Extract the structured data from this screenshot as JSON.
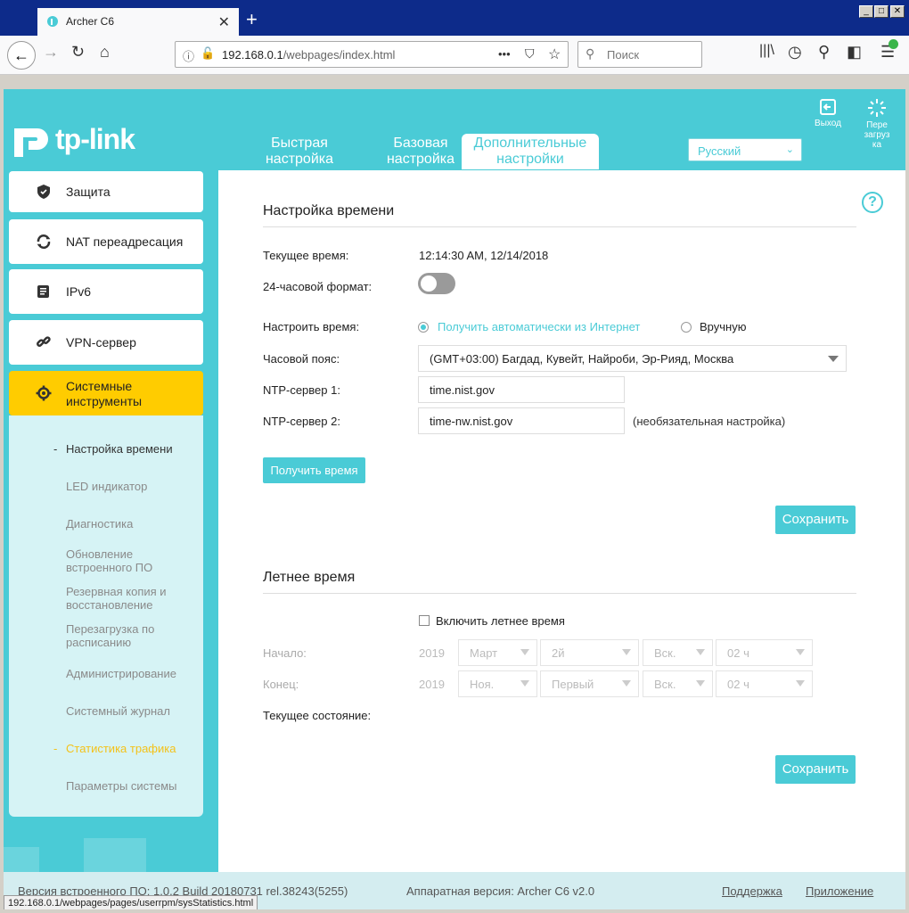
{
  "browser": {
    "tab_title": "Archer C6",
    "new_tab": "+",
    "url_host": "192.168.0.1",
    "url_path": "/webpages/index.html",
    "search_placeholder": "Поиск",
    "more": "•••"
  },
  "header": {
    "logo": "tp-link",
    "tabs": [
      {
        "label_l1": "Быстрая",
        "label_l2": "настройка"
      },
      {
        "label_l1": "Базовая",
        "label_l2": "настройка"
      },
      {
        "label_l1": "Дополнительные",
        "label_l2": "настройки"
      }
    ],
    "language": "Русский",
    "logout": "Выход",
    "reboot_l1": "Пере",
    "reboot_l2": "загруз",
    "reboot_l3": "ка"
  },
  "sidebar": {
    "items": [
      {
        "label": "Защита"
      },
      {
        "label": "NAT переадресация"
      },
      {
        "label": "IPv6"
      },
      {
        "label": "VPN-сервер"
      }
    ],
    "active_l1": "Системные",
    "active_l2": "инструменты",
    "sub": [
      {
        "label": "Настройка времени"
      },
      {
        "label": "LED индикатор"
      },
      {
        "label": "Диагностика"
      },
      {
        "label_l1": "Обновление",
        "label_l2": "встроенного ПО"
      },
      {
        "label_l1": "Резервная копия и",
        "label_l2": "восстановление"
      },
      {
        "label_l1": "Перезагрузка по",
        "label_l2": "расписанию"
      },
      {
        "label": "Администрирование"
      },
      {
        "label": "Системный журнал"
      },
      {
        "label": "Статистика трафика"
      },
      {
        "label": "Параметры системы"
      }
    ]
  },
  "time": {
    "title": "Настройка времени",
    "current_label": "Текущее время:",
    "current_value": "12:14:30 AM, 12/14/2018",
    "format24_label": "24-часовой формат:",
    "set_label": "Настроить время:",
    "auto_option": "Получить автоматически из Интернет",
    "manual_option": "Вручную",
    "tz_label": "Часовой пояс:",
    "tz_value": "(GMT+03:00) Багдад, Кувейт, Найроби, Эр-Рияд, Москва",
    "ntp1_label": "NTP-сервер 1:",
    "ntp1_value": "time.nist.gov",
    "ntp2_label": "NTP-сервер 2:",
    "ntp2_value": "time-nw.nist.gov",
    "ntp2_note": "(необязательная настройка)",
    "get_time_button": "Получить время",
    "save_button": "Сохранить"
  },
  "dst": {
    "title": "Летнее время",
    "enable_label": "Включить летнее время",
    "start_label": "Начало:",
    "end_label": "Конец:",
    "start_year": "2019",
    "end_year": "2019",
    "start_month": "Март",
    "start_week": "2й",
    "start_day": "Вск.",
    "start_hour": "02 ч",
    "end_month": "Ноя.",
    "end_week": "Первый",
    "end_day": "Вск.",
    "end_hour": "02 ч",
    "status_label": "Текущее состояние:",
    "save_button": "Сохранить"
  },
  "footer": {
    "firmware": "Версия встроенного ПО: 1.0.2 Build 20180731 rel.38243(5255)",
    "hardware": "Аппаратная версия: Archer C6 v2.0",
    "support": "Поддержка",
    "app": "Приложение"
  },
  "statusbar": "192.168.0.1/webpages/pages/userrpm/sysStatistics.html",
  "colors": {
    "accent": "#4acbd6",
    "active_menu": "#ffcc00",
    "link": "#f4c21a"
  }
}
